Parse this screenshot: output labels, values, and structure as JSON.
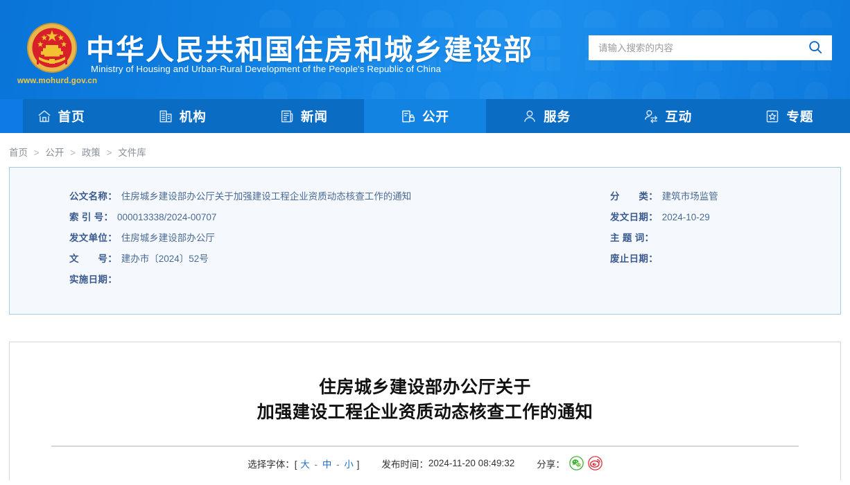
{
  "banner": {
    "title_cn": "中华人民共和国住房和城乡建设部",
    "title_en": "Ministry of Housing and Urban-Rural Development of the People's Republic of China",
    "site_url": "www.mohurd.gov.cn",
    "emblem_alt": "national-emblem"
  },
  "search": {
    "placeholder": "请输入搜索的内容",
    "value": "",
    "button_icon": "search-icon"
  },
  "nav": {
    "items": [
      {
        "label": "首页",
        "icon": "home-icon",
        "active": false
      },
      {
        "label": "机构",
        "icon": "building-icon",
        "active": false
      },
      {
        "label": "新闻",
        "icon": "news-icon",
        "active": false
      },
      {
        "label": "公开",
        "icon": "disclosure-icon",
        "active": true
      },
      {
        "label": "服务",
        "icon": "service-icon",
        "active": false
      },
      {
        "label": "互动",
        "icon": "interaction-icon",
        "active": false
      },
      {
        "label": "专题",
        "icon": "topic-icon",
        "active": false
      }
    ]
  },
  "breadcrumb": {
    "items": [
      "首页",
      "公开",
      "政策",
      "文件库"
    ],
    "separator": ">"
  },
  "meta": {
    "left": [
      {
        "label": "公文名称",
        "value": "住房城乡建设部办公厅关于加强建设工程企业资质动态核查工作的通知"
      },
      {
        "label": "索 引 号",
        "value": "000013338/2024-00707"
      },
      {
        "label": "发文单位",
        "value": "住房城乡建设部办公厅"
      },
      {
        "label": "文　　号",
        "value": "建办市〔2024〕52号"
      },
      {
        "label": "实施日期",
        "value": ""
      }
    ],
    "right": [
      {
        "label": "分　　类",
        "value": "建筑市场监管"
      },
      {
        "label": "发文日期",
        "value": "2024-10-29"
      },
      {
        "label": "主 题 词",
        "value": ""
      },
      {
        "label": "废止日期",
        "value": ""
      }
    ]
  },
  "document": {
    "title_line1": "住房城乡建设部办公厅关于",
    "title_line2": "加强建设工程企业资质动态核查工作的通知",
    "font_label": "选择字体：",
    "font_bracket_open": "[",
    "font_bracket_close": "]",
    "font_sizes": [
      "大",
      "中",
      "小"
    ],
    "font_dash": "-",
    "publish_label": "发布时间：",
    "publish_time": "2024-11-20 08:49:32",
    "share_label": "分享：",
    "share_icons": [
      "wechat-icon",
      "weibo-icon"
    ]
  },
  "colors": {
    "banner_blue": "#1184e6",
    "nav_blue": "#0b6cc4",
    "nav_active": "#1283e0",
    "meta_bg": "#f5f9fd",
    "meta_border": "#a8cbea",
    "meta_label": "#3a5a8f",
    "link_blue": "#1f6fc4",
    "emblem_gold": "#e8b84b",
    "emblem_red": "#d8202a",
    "wechat_green": "#3eb134",
    "weibo_red": "#e02f3d"
  }
}
